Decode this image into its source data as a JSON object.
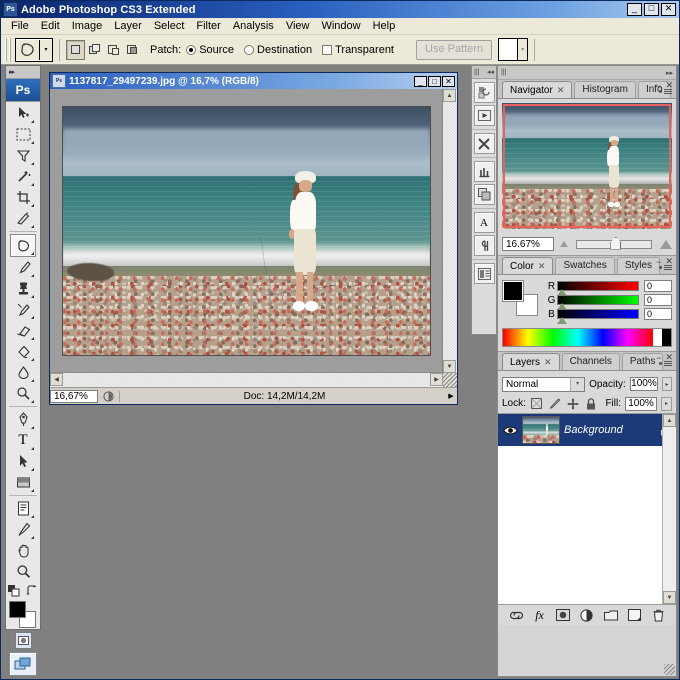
{
  "app": {
    "title": "Adobe Photoshop CS3 Extended",
    "logo_text": "Ps",
    "window_buttons": {
      "minimize": "_",
      "maximize": "□",
      "close": "✕"
    }
  },
  "menubar": {
    "items": [
      "File",
      "Edit",
      "Image",
      "Layer",
      "Select",
      "Filter",
      "Analysis",
      "View",
      "Window",
      "Help"
    ]
  },
  "options_bar": {
    "tool_icon": "patch-tool-icon",
    "preset_arrow": "▾",
    "selection_modes": [
      "new-selection",
      "add-to-selection",
      "subtract-from-selection",
      "intersect-selection"
    ],
    "patch_label": "Patch:",
    "source_label": "Source",
    "destination_label": "Destination",
    "transparent_label": "Transparent",
    "source_selected": true,
    "destination_selected": false,
    "transparent_checked": false,
    "use_pattern_label": "Use Pattern",
    "use_pattern_disabled": true,
    "pattern_arrow": "▾"
  },
  "toolbox": {
    "logo": "Ps",
    "collapse_arrows": "▸▸",
    "tools": [
      {
        "name": "move-tool",
        "glyph": "move"
      },
      {
        "name": "marquee-tool",
        "glyph": "marquee"
      },
      {
        "name": "lasso-tool",
        "glyph": "lasso"
      },
      {
        "name": "magic-wand-tool",
        "glyph": "wand"
      },
      {
        "name": "crop-tool",
        "glyph": "crop"
      },
      {
        "name": "slice-tool",
        "glyph": "slice"
      },
      {
        "name": "patch-tool",
        "glyph": "patch",
        "selected": true
      },
      {
        "name": "brush-tool",
        "glyph": "brush"
      },
      {
        "name": "clone-stamp-tool",
        "glyph": "stamp"
      },
      {
        "name": "history-brush-tool",
        "glyph": "historybrush"
      },
      {
        "name": "eraser-tool",
        "glyph": "eraser"
      },
      {
        "name": "gradient-tool",
        "glyph": "bucket"
      },
      {
        "name": "blur-tool",
        "glyph": "drop"
      },
      {
        "name": "dodge-tool",
        "glyph": "dodge"
      },
      {
        "name": "pen-tool",
        "glyph": "pen"
      },
      {
        "name": "type-tool",
        "glyph": "T"
      },
      {
        "name": "path-selection-tool",
        "glyph": "arrow"
      },
      {
        "name": "rectangle-tool",
        "glyph": "rect"
      },
      {
        "name": "notes-tool",
        "glyph": "note"
      },
      {
        "name": "eyedropper-tool",
        "glyph": "eyedropper"
      },
      {
        "name": "hand-tool",
        "glyph": "hand"
      },
      {
        "name": "zoom-tool",
        "glyph": "zoom"
      }
    ],
    "foreground_color": "#000000",
    "background_color": "#ffffff",
    "quick_mask_standard": "standard-mode",
    "quick_mask_edit": "quick-mask-mode",
    "screen_mode": "screen-mode-icon"
  },
  "document": {
    "title": "1137817_29497239.jpg @ 16,7% (RGB/8)",
    "window_buttons": {
      "minimize": "_",
      "maximize": "□",
      "close": "✕"
    },
    "status": {
      "zoom": "16,67%",
      "doc_info": "Doc: 14,2M/14,2M",
      "arrow": "▶"
    },
    "image_description": "beach-photo-woman-on-pebble-shore"
  },
  "dock_strip": {
    "collapse_arrows": "◂◂",
    "expand_arrows": "▸▸",
    "buttons": [
      {
        "name": "history-panel-icon",
        "glyph": "history"
      },
      {
        "name": "actions-panel-icon",
        "glyph": "play"
      },
      {
        "name": "tool-presets-panel-icon",
        "glyph": "tools"
      },
      {
        "name": "brushes-panel-icon",
        "glyph": "brushes"
      },
      {
        "name": "clone-source-panel-icon",
        "glyph": "clonesource"
      },
      {
        "name": "character-panel-icon",
        "glyph": "A"
      },
      {
        "name": "paragraph-panel-icon",
        "glyph": "pilcrow"
      },
      {
        "name": "layer-comps-panel-icon",
        "glyph": "layercomps"
      }
    ]
  },
  "navigator_panel": {
    "tabs": [
      {
        "label": "Navigator",
        "active": true,
        "closeable": true
      },
      {
        "label": "Histogram",
        "active": false,
        "closeable": false
      },
      {
        "label": "Info",
        "active": false,
        "closeable": false
      }
    ],
    "zoom_value": "16.67%",
    "zoom_out_icon": "small-mountain-icon",
    "zoom_in_icon": "large-mountain-icon",
    "view_box_color": "#e8615a",
    "minimize_icon": "−",
    "close_icon": "✕"
  },
  "color_panel": {
    "tabs": [
      {
        "label": "Color",
        "active": true,
        "closeable": true
      },
      {
        "label": "Swatches",
        "active": false,
        "closeable": false
      },
      {
        "label": "Styles",
        "active": false,
        "closeable": false
      }
    ],
    "foreground": "#000000",
    "background": "#ffffff",
    "channels": [
      {
        "label": "R",
        "value": "0"
      },
      {
        "label": "G",
        "value": "0"
      },
      {
        "label": "B",
        "value": "0"
      }
    ],
    "minimize_icon": "−",
    "close_icon": "✕"
  },
  "layers_panel": {
    "tabs": [
      {
        "label": "Layers",
        "active": true,
        "closeable": true
      },
      {
        "label": "Channels",
        "active": false,
        "closeable": false
      },
      {
        "label": "Paths",
        "active": false,
        "closeable": false
      }
    ],
    "blend_mode": "Normal",
    "blend_arrow": "▾",
    "opacity_label": "Opacity:",
    "opacity_value": "100%",
    "lock_label": "Lock:",
    "fill_label": "Fill:",
    "fill_value": "100%",
    "spin_arrow": "▸",
    "lock_buttons": [
      "lock-transparent-pixels",
      "lock-image-pixels",
      "lock-position",
      "lock-all"
    ],
    "layers": [
      {
        "name": "Background",
        "visible": true,
        "locked": true,
        "selected": true
      }
    ],
    "footer_buttons": [
      {
        "name": "link-layers-icon",
        "glyph": "link"
      },
      {
        "name": "layer-style-icon",
        "glyph": "fx"
      },
      {
        "name": "add-layer-mask-icon",
        "glyph": "mask"
      },
      {
        "name": "new-adjustment-layer-icon",
        "glyph": "adjust"
      },
      {
        "name": "new-group-icon",
        "glyph": "folder"
      },
      {
        "name": "new-layer-icon",
        "glyph": "newlayer"
      },
      {
        "name": "delete-layer-icon",
        "glyph": "trash"
      }
    ],
    "minimize_icon": "−",
    "close_icon": "✕"
  },
  "colors": {
    "title_gradient_start": "#0a246a",
    "title_gradient_end": "#a8c8ee",
    "chrome": "#ece9d8",
    "panel_bg": "#d9d9d9",
    "workspace": "#808080",
    "selected_layer": "#1b3a77"
  }
}
